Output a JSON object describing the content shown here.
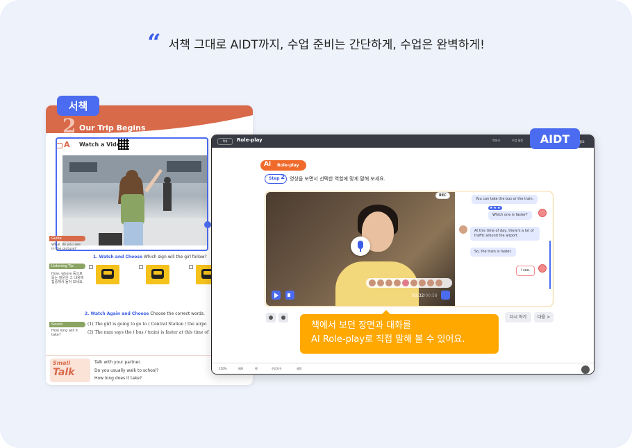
{
  "headline": {
    "quote_icon": "quote-mark-icon",
    "text": "서책 그대로 AIDT까지, 수업 준비는 간단하게, 수업은 완벽하게!"
  },
  "book": {
    "tag": "서책",
    "lesson_number": "2",
    "lesson_title": "Our Trip Begins",
    "section_letter": "A",
    "section_title": "Watch a Video",
    "sidebar": [
      {
        "label": "Guide",
        "text": "What do you see in the picture?"
      },
      {
        "label": "Listening Tip",
        "text": "How, where 등으로 묻는 질문은 그 내용에 집중해서 들어 보세요."
      },
      {
        "label": "Sound",
        "text": "How long will it take?"
      }
    ],
    "q1_heading_num": "1. Watch and Choose",
    "q1_heading_text": "Which sign will the girl follow?",
    "q2_heading_num": "2. Watch Again and Choose",
    "q2_heading_text": "Choose the correct words.",
    "q2_line1": "(1)  The girl is going to go to (   Central Station /    the airpo",
    "q2_line2": "(2)  The man says the (   bus /    train) is faster at this time of",
    "small_talk": {
      "logo_top": "Small",
      "logo_bottom": "Talk",
      "prompt": "Talk with your partner.",
      "q1": "Do you usually walk to school?",
      "q2": "How long does it take?"
    }
  },
  "aidt": {
    "tag": "AIDT",
    "menu_label": "목차",
    "title": "Role-play",
    "bar_items": [
      "북마크",
      "수업 설정"
    ],
    "close_label": "종료",
    "badge_ai": "Ai",
    "badge_label": "Role-play",
    "step_label": "Step",
    "step_number": "2",
    "instruction": "영상을 보면서 선택한 역할에 맞게 말해 보세요.",
    "rec_label": "REC",
    "time_current": "00:32",
    "time_total": "/00:58",
    "chat": [
      {
        "text": "You can take the bus or the train."
      },
      {
        "text": "Which one is faster?",
        "stars": "★★★"
      },
      {
        "text": "At this time of day, there's a lot of traffic around the airport."
      },
      {
        "text": "So, the train is faster."
      },
      {
        "text": "I see."
      }
    ],
    "buttons": {
      "retry": "다시 하기",
      "next": "다음 >"
    },
    "callout_line1": "책에서 보던 장면과 대화를",
    "callout_line2": "AI Role-play로 직접 말해 볼 수 있어요.",
    "status": [
      "150%",
      "메모",
      "펜",
      "수업도구",
      "설정"
    ]
  },
  "colors": {
    "accent": "#4b6cf0",
    "orange": "#ffa800",
    "brand_red": "#d86a4a"
  }
}
